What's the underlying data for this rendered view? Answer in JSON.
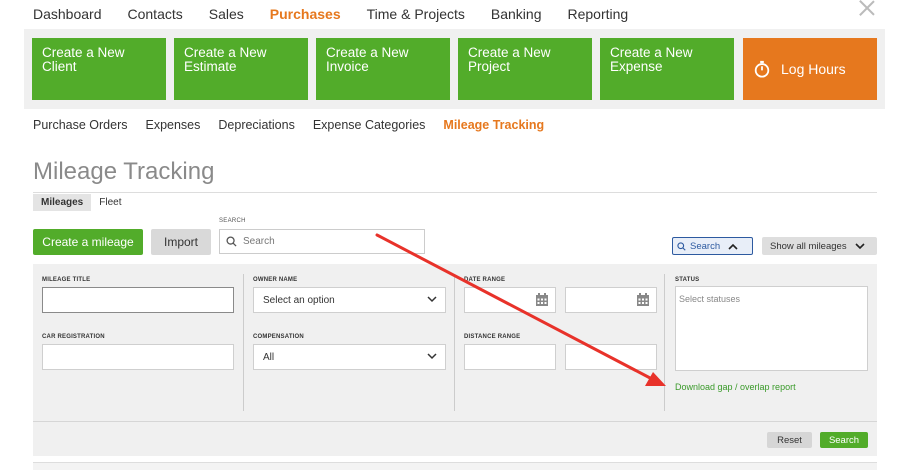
{
  "topnav": {
    "items": [
      "Dashboard",
      "Contacts",
      "Sales",
      "Purchases",
      "Time & Projects",
      "Banking",
      "Reporting"
    ],
    "active_index": 3
  },
  "tiles": [
    {
      "line1": "Create a New",
      "line2": "Client"
    },
    {
      "line1": "Create a New",
      "line2": "Estimate"
    },
    {
      "line1": "Create a New",
      "line2": "Invoice"
    },
    {
      "line1": "Create a New",
      "line2": "Project"
    },
    {
      "line1": "Create a New",
      "line2": "Expense"
    }
  ],
  "log_hours": {
    "label": "Log Hours",
    "icon": "stopwatch-icon"
  },
  "subnav": {
    "items": [
      "Purchase Orders",
      "Expenses",
      "Depreciations",
      "Expense Categories",
      "Mileage Tracking"
    ],
    "active_index": 4
  },
  "page": {
    "title": "Mileage Tracking"
  },
  "tabs": {
    "items": [
      "Mileages",
      "Fleet"
    ],
    "active_index": 0
  },
  "toolbar": {
    "create_label": "Create a mileage",
    "import_label": "Import",
    "search_label": "SEARCH",
    "search_placeholder": "Search",
    "search_toggle_label": "Search",
    "show_all_label": "Show all mileages"
  },
  "filters": {
    "mileage_title_label": "MILEAGE TITLE",
    "owner_name_label": "OWNER NAME",
    "owner_name_value": "Select an option",
    "date_range_label": "DATE RANGE",
    "status_label": "STATUS",
    "status_placeholder": "Select statuses",
    "car_registration_label": "CAR REGISTRATION",
    "compensation_label": "COMPENSATION",
    "compensation_value": "All",
    "distance_range_label": "DISTANCE RANGE",
    "download_link": "Download gap / overlap report",
    "reset_label": "Reset",
    "search_button_label": "Search"
  },
  "colors": {
    "brand_green": "#52ac2a",
    "brand_orange": "#e6781e",
    "annotation_red": "#e8322a",
    "link_green": "#3a9a2a"
  }
}
